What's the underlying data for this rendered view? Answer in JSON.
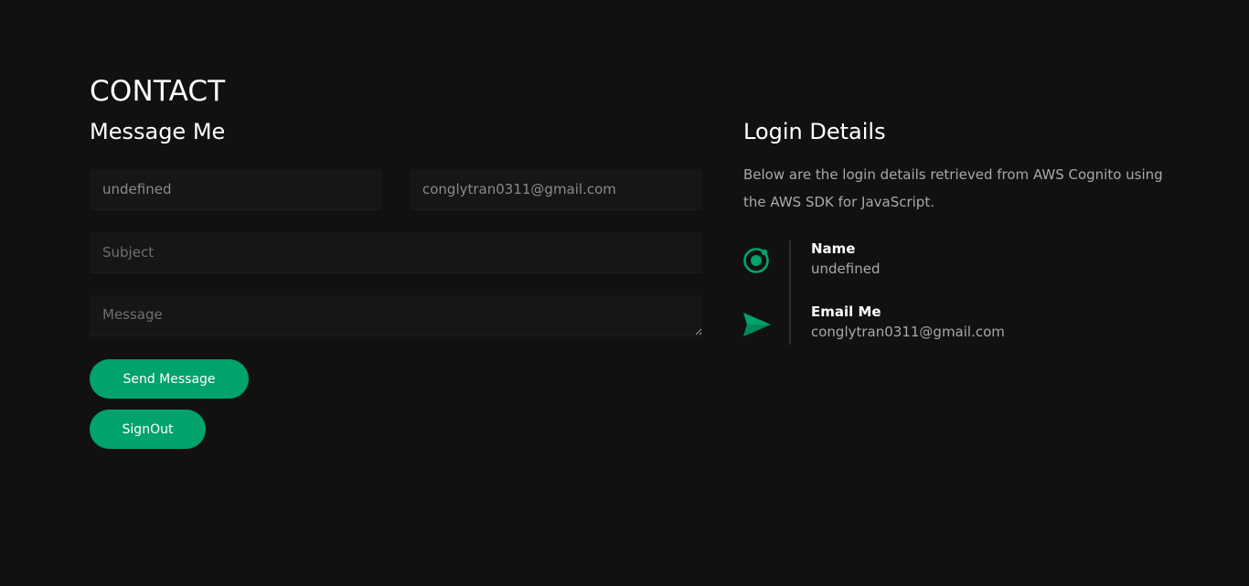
{
  "contact": {
    "title": "CONTACT",
    "form_heading": "Message Me",
    "fields": {
      "name_value": "undefined",
      "email_value": "conglytran0311@gmail.com",
      "subject_placeholder": "Subject",
      "message_placeholder": "Message"
    },
    "buttons": {
      "send_label": "Send Message",
      "signout_label": "SignOut"
    }
  },
  "login_details": {
    "heading": "Login Details",
    "description": "Below are the login details retrieved from AWS Cognito using the AWS SDK for JavaScript.",
    "items": [
      {
        "icon": "ionic-logo-icon",
        "label": "Name",
        "value": "undefined"
      },
      {
        "icon": "send-icon",
        "label": "Email Me",
        "value": "conglytran0311@gmail.com"
      }
    ]
  },
  "colors": {
    "background": "#111111",
    "field_background": "#161616",
    "accent": "#00a36c",
    "text_muted": "#a8a8a8"
  }
}
